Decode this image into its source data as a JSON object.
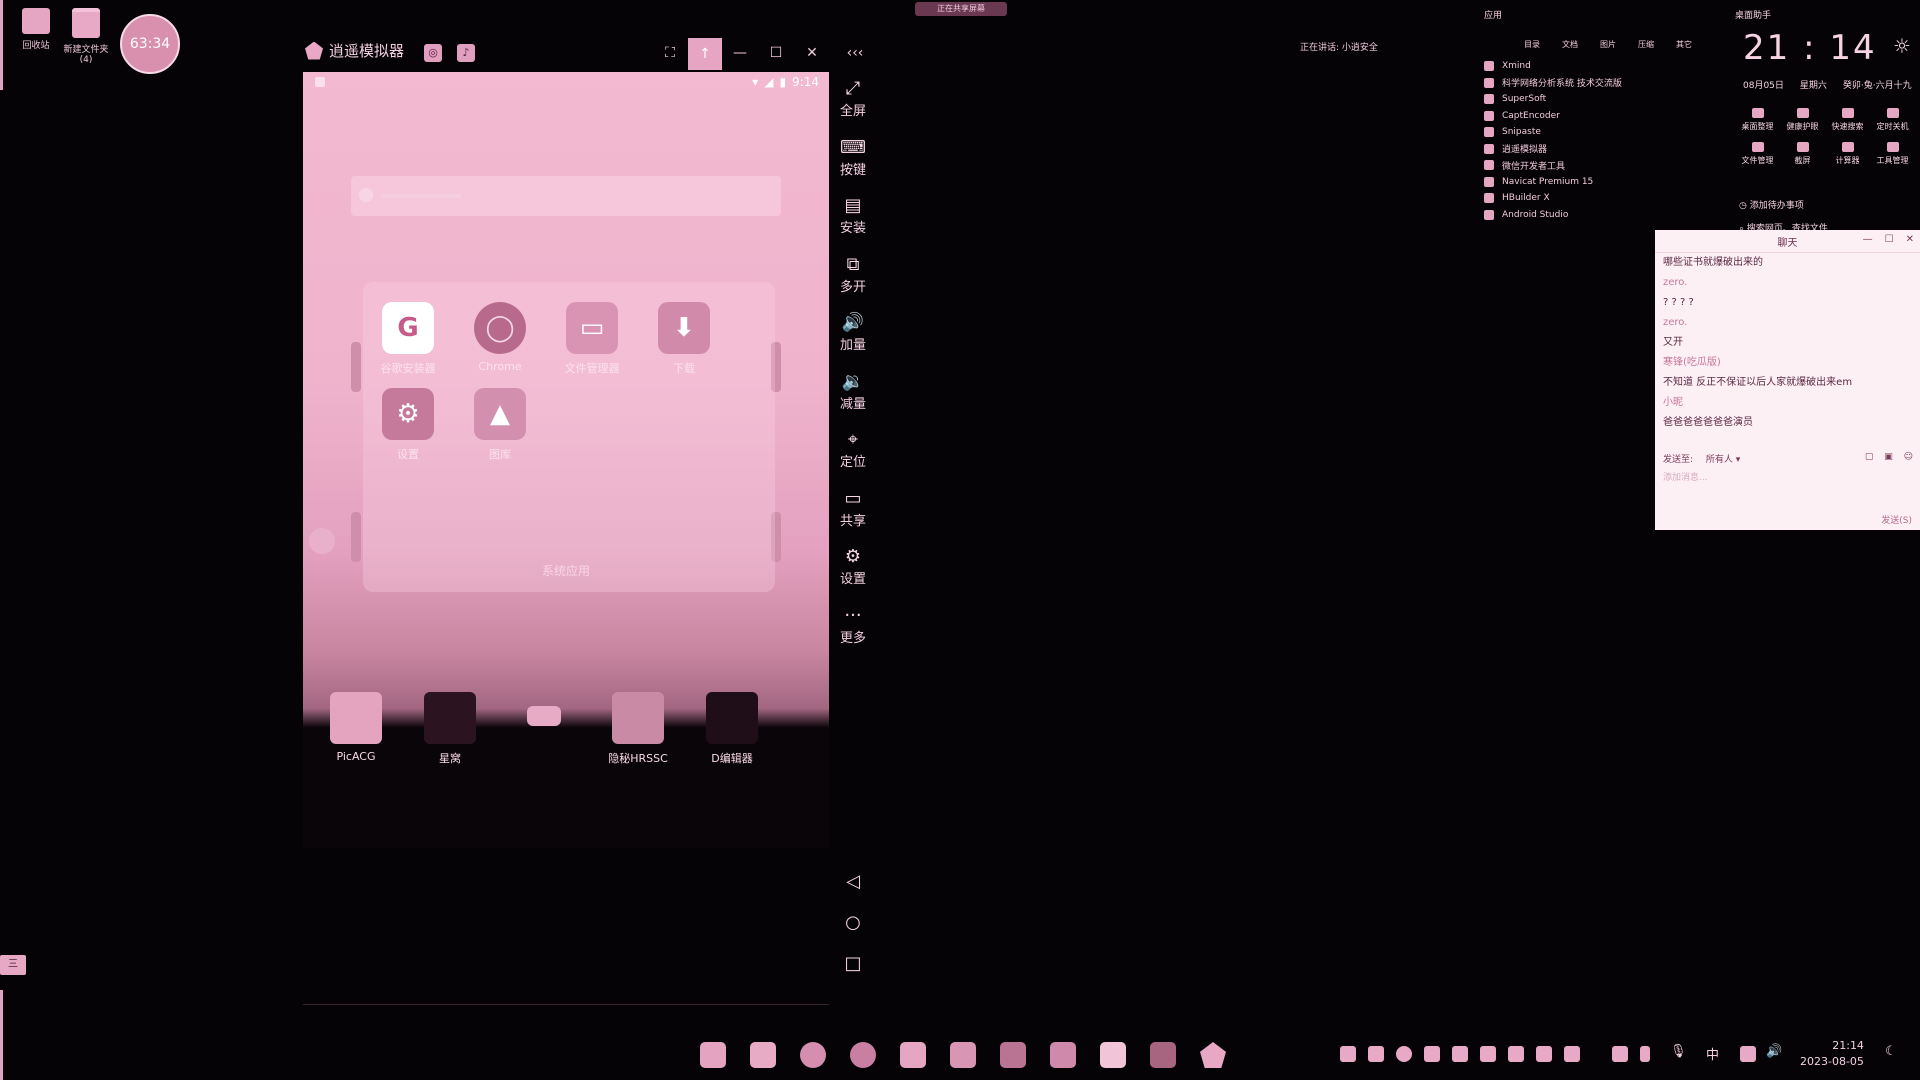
{
  "desktop": {
    "icons": [
      {
        "label": "回收站"
      },
      {
        "label": "新建文件夹 (4)"
      }
    ],
    "timer": "63:34",
    "left_tag": "三"
  },
  "top_banner": "正在共享屏幕",
  "emulator": {
    "title": "逍遥模拟器",
    "chip1": "◎",
    "chip2": "♪",
    "controls": {
      "fullscreen": "⛶",
      "top": "↑",
      "minimize": "—",
      "maximize": "☐",
      "close": "✕",
      "collapse": "‹‹‹"
    },
    "phone": {
      "time": "9:14",
      "folder_name": "系统应用",
      "folder_apps": [
        {
          "label": "谷歌安装器",
          "icon": "google-icon",
          "glyph": "G",
          "bg": "#ffffff",
          "fg": "#c75a8a"
        },
        {
          "label": "Chrome",
          "icon": "chrome-icon",
          "glyph": "◯",
          "bg": "#b86a8c",
          "fg": "#f3d7e4"
        },
        {
          "label": "文件管理器",
          "icon": "folder-icon",
          "glyph": "▭",
          "bg": "#d993b3",
          "fg": "#ffffff"
        },
        {
          "label": "下载",
          "icon": "download-icon",
          "glyph": "⬇",
          "bg": "#d28aab",
          "fg": "#ffffff"
        },
        {
          "label": "设置",
          "icon": "settings-icon",
          "glyph": "⚙",
          "bg": "#c57a9c",
          "fg": "#ffffff"
        },
        {
          "label": "图库",
          "icon": "gallery-icon",
          "glyph": "▲",
          "bg": "#d28fae",
          "fg": "#ffffff"
        }
      ],
      "dock_apps": [
        {
          "label": "PicACG",
          "icon": "picacg-icon",
          "bg": "#e4a4c0"
        },
        {
          "label": "星窝",
          "icon": "ghost-icon",
          "bg": "#2b1420"
        },
        {
          "label": "",
          "icon": "small-app-icon",
          "bg": "#e7abc6"
        },
        {
          "label": "隐秘HRSSC",
          "icon": "heart-icon",
          "bg": "#c98aa6"
        },
        {
          "label": "D编辑器",
          "icon": "d-editor-icon",
          "bg": "#1f0d17"
        }
      ]
    },
    "sidebar": [
      {
        "label": "全屏",
        "icon": "fullscreen-icon",
        "glyph": "⤢"
      },
      {
        "label": "按键",
        "icon": "keyboard-icon",
        "glyph": "⌨"
      },
      {
        "label": "安装",
        "icon": "apk-icon",
        "glyph": "▤"
      },
      {
        "label": "多开",
        "icon": "multi-open-icon",
        "glyph": "⧉"
      },
      {
        "label": "加量",
        "icon": "volume-up-icon",
        "glyph": "🔊"
      },
      {
        "label": "减量",
        "icon": "volume-down-icon",
        "glyph": "🔉"
      },
      {
        "label": "定位",
        "icon": "location-icon",
        "glyph": "⌖"
      },
      {
        "label": "共享",
        "icon": "share-folder-icon",
        "glyph": "▭"
      },
      {
        "label": "设置",
        "icon": "gear-icon",
        "glyph": "⚙"
      },
      {
        "label": "更多",
        "icon": "more-icon",
        "glyph": "···"
      }
    ],
    "nav": {
      "back": "◁",
      "home": "○",
      "recent": "□"
    }
  },
  "widget": {
    "speaking": "正在讲话: 小逍安全",
    "apps_title": "应用",
    "apps_header": [
      "目录",
      "文档",
      "图片",
      "压缩",
      "其它"
    ],
    "apps": [
      "Xmind",
      "科学网络分析系统 技术交流版",
      "SuperSoft",
      "CaptEncoder",
      "Snipaste",
      "逍遥模拟器",
      "微信开发者工具",
      "Navicat Premium 15",
      "HBuilder X",
      "Android Studio"
    ],
    "assistant_title": "桌面助手",
    "clock": "21 : 14",
    "date": "08月05日",
    "weekday": "星期六",
    "lunar": "癸卯·兔·六月十九",
    "quick_actions": [
      "桌面整理",
      "健康护眼",
      "快速搜索",
      "定时关机",
      "文件管理",
      "截屏",
      "计算器",
      "工具管理"
    ],
    "todo": "添加待办事项",
    "search_files": "搜索网页、查找文件"
  },
  "chat": {
    "title": "聊天",
    "messages": [
      {
        "name": "",
        "text": "哪些证书就爆破出来的"
      },
      {
        "name": "zero.",
        "text": "? ? ? ?"
      },
      {
        "name": "zero.",
        "text": "又开"
      },
      {
        "name": "寒锋(吃瓜版)",
        "text": "不知道 反正不保证以后人家就爆破出来em"
      },
      {
        "name": "小昵",
        "text": "爸爸爸爸爸爸爸演员"
      }
    ],
    "send_to_label": "发送至:",
    "send_to_value": "所有人 ▾",
    "input_placeholder": "添加消息...",
    "send_button": "发送(S)"
  },
  "taskbar": {
    "time": "21:14",
    "date": "2023-08-05",
    "ime": "中"
  }
}
